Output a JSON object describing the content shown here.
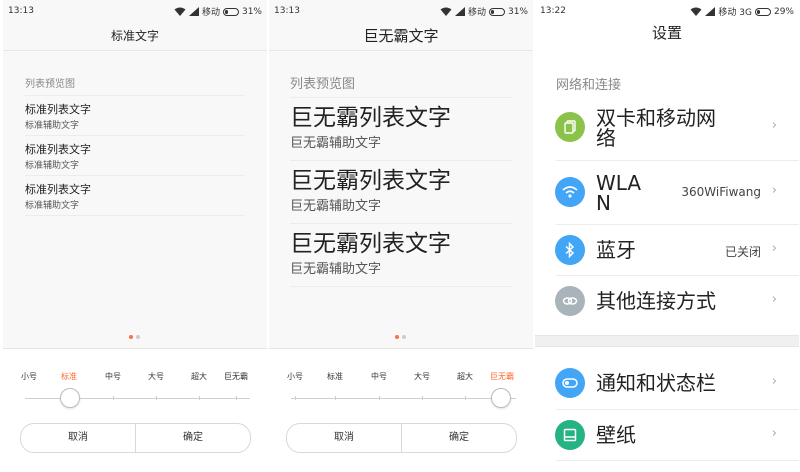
{
  "screens": [
    {
      "status": {
        "time": "13:13",
        "carrier": "移动",
        "battery": "31%"
      },
      "title": "标准文字",
      "section_label": "列表预览图",
      "items": [
        {
          "main": "标准列表文字",
          "sub": "标准辅助文字"
        },
        {
          "main": "标准列表文字",
          "sub": "标准辅助文字"
        },
        {
          "main": "标准列表文字",
          "sub": "标准辅助文字"
        }
      ],
      "page_indicator": {
        "count": 2,
        "active": 1
      },
      "sizes": [
        "小号",
        "标准",
        "中号",
        "大号",
        "超大",
        "巨无霸"
      ],
      "selected_size": "标准",
      "slider_level_index": 1,
      "buttons": {
        "cancel": "取消",
        "confirm": "确定"
      }
    },
    {
      "status": {
        "time": "13:13",
        "carrier": "移动",
        "battery": "31%"
      },
      "title": "巨无霸文字",
      "section_label": "列表预览图",
      "items": [
        {
          "main": "巨无霸列表文字",
          "sub": "巨无霸辅助文字"
        },
        {
          "main": "巨无霸列表文字",
          "sub": "巨无霸辅助文字"
        },
        {
          "main": "巨无霸列表文字",
          "sub": "巨无霸辅助文字"
        }
      ],
      "page_indicator": {
        "count": 2,
        "active": 1
      },
      "sizes": [
        "小号",
        "标准",
        "中号",
        "大号",
        "超大",
        "巨无霸"
      ],
      "selected_size": "巨无霸",
      "slider_level_index": 5,
      "buttons": {
        "cancel": "取消",
        "confirm": "确定"
      }
    },
    {
      "status": {
        "time": "13:22",
        "carrier": "移动 3G",
        "battery": "29%"
      },
      "title": "设置",
      "section_label": "网络和连接",
      "rows": [
        {
          "label": "双卡和移动网络",
          "value": "",
          "icon": "sim-cards-icon",
          "color": "#8bc34a"
        },
        {
          "label": "WLAN",
          "value": "360WiFiwang",
          "icon": "wifi-icon",
          "color": "#42a5f5"
        },
        {
          "label": "蓝牙",
          "value": "已关闭",
          "icon": "bluetooth-icon",
          "color": "#42a5f5"
        },
        {
          "label": "其他连接方式",
          "value": "",
          "icon": "link-icon",
          "color": "#a9b3ba"
        },
        {
          "label": "通知和状态栏",
          "value": "",
          "icon": "toggle-icon",
          "color": "#42a5f5"
        },
        {
          "label": "壁纸",
          "value": "",
          "icon": "wallpaper-icon",
          "color": "#26b383"
        }
      ]
    }
  ],
  "colors": {
    "accent": "#ff6a2a",
    "divider": "#ececec"
  }
}
